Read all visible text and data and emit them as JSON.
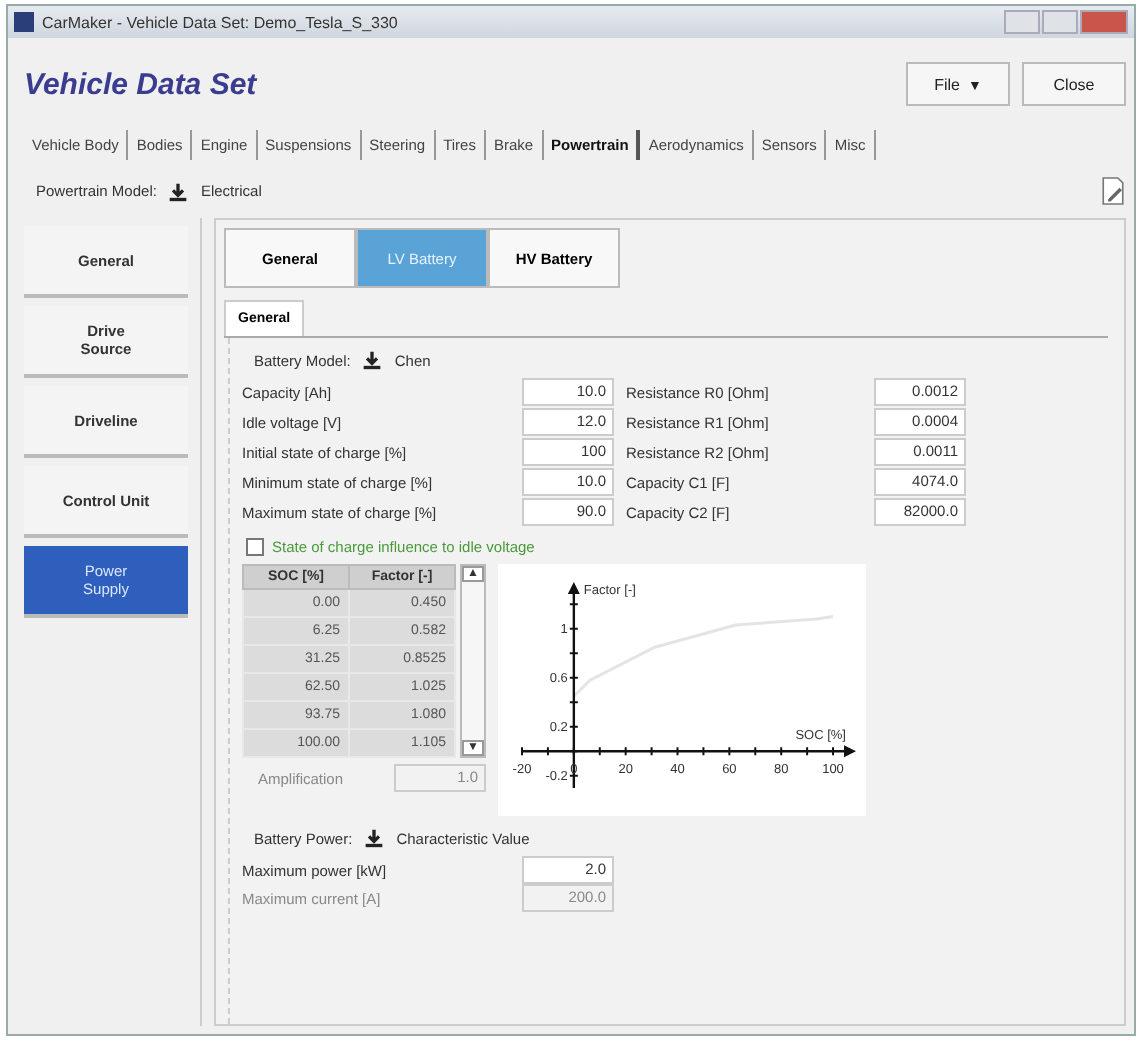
{
  "window": {
    "title": "CarMaker - Vehicle Data Set: Demo_Tesla_S_330"
  },
  "header": {
    "title": "Vehicle Data Set",
    "buttons": [
      {
        "label": "File",
        "kind": "menu",
        "caret": "▼"
      },
      {
        "label": "Close",
        "kind": "plain"
      }
    ]
  },
  "tabs": [
    {
      "label": "Vehicle Body",
      "selected": false
    },
    {
      "label": "Bodies",
      "selected": false
    },
    {
      "label": "Engine",
      "selected": false
    },
    {
      "label": "Suspensions",
      "selected": false
    },
    {
      "label": "Steering",
      "selected": false
    },
    {
      "label": "Tires",
      "selected": false
    },
    {
      "label": "Brake",
      "selected": false
    },
    {
      "label": "Powertrain",
      "selected": true
    },
    {
      "label": "Aerodynamics",
      "selected": false
    },
    {
      "label": "Sensors",
      "selected": false
    },
    {
      "label": "Misc",
      "selected": false
    }
  ],
  "model": {
    "label": "Powertrain Model:",
    "value": "Electrical"
  },
  "sidebar": {
    "items": [
      {
        "label": "General",
        "selected": false
      },
      {
        "label": "Drive Source",
        "selected": false
      },
      {
        "label": "Driveline",
        "selected": false
      },
      {
        "label": "Control Unit",
        "selected": false
      },
      {
        "label": "Power Supply",
        "selected": true
      }
    ]
  },
  "subtabs": [
    {
      "label": "General",
      "selected": false
    },
    {
      "label": "LV Battery",
      "selected": true
    },
    {
      "label": "HV Battery",
      "selected": false
    }
  ],
  "inner_tabs": [
    {
      "label": "General",
      "selected": true
    }
  ],
  "battery_model": {
    "label": "Battery Model:",
    "value": "Chen"
  },
  "params_left": [
    {
      "label": "Capacity [Ah]",
      "value": "10.0"
    },
    {
      "label": "Idle voltage [V]",
      "value": "12.0"
    },
    {
      "label": "Initial state of charge [%]",
      "value": "100"
    },
    {
      "label": "Minimum state of charge [%]",
      "value": "10.0"
    },
    {
      "label": "Maximum state of charge [%]",
      "value": "90.0"
    }
  ],
  "params_right": [
    {
      "label": "Resistance R0 [Ohm]",
      "value": "0.0012"
    },
    {
      "label": "Resistance R1 [Ohm]",
      "value": "0.0004"
    },
    {
      "label": "Resistance R2 [Ohm]",
      "value": "0.0011"
    },
    {
      "label": "Capacity C1 [F]",
      "value": "4074.0"
    },
    {
      "label": "Capacity C2 [F]",
      "value": "82000.0"
    }
  ],
  "checkbox": {
    "label": "State of charge influence to idle voltage",
    "checked": false
  },
  "table": {
    "scroll_up": "▲",
    "scroll_down": "▼",
    "columns": [
      "SOC [%]",
      "Factor [-]"
    ],
    "rows": [
      [
        "0.00",
        "0.450"
      ],
      [
        "6.25",
        "0.582"
      ],
      [
        "31.25",
        "0.8525"
      ],
      [
        "62.50",
        "1.025"
      ],
      [
        "93.75",
        "1.080"
      ],
      [
        "100.00",
        "1.105"
      ]
    ]
  },
  "amplification": {
    "label": "Amplification",
    "value": "1.0",
    "disabled": true
  },
  "chart": {
    "chart_data": {
      "type": "line",
      "xlabel": "SOC [%]",
      "ylabel": "Factor [-]",
      "x": [
        0,
        6.25,
        31.25,
        62.5,
        93.75,
        100
      ],
      "series": [
        {
          "color": "#e4e4e4",
          "values": [
            0.45,
            0.58,
            0.85,
            1.03,
            1.08,
            1.1
          ]
        }
      ],
      "xlim": [
        -20,
        105
      ],
      "ylim": [
        -0.3,
        1.3
      ],
      "xticks": [
        -20,
        0,
        20,
        40,
        60,
        80,
        100
      ],
      "yticks": [
        -0.2,
        0.2,
        0.6,
        1
      ]
    }
  },
  "battery_power": {
    "label": "Battery Power:",
    "value": "Characteristic Value"
  },
  "power_fields": [
    {
      "label": "Maximum power [kW]",
      "value": "2.0",
      "disabled": false
    },
    {
      "label": "Maximum current [A]",
      "value": "200.0",
      "disabled": true
    }
  ]
}
